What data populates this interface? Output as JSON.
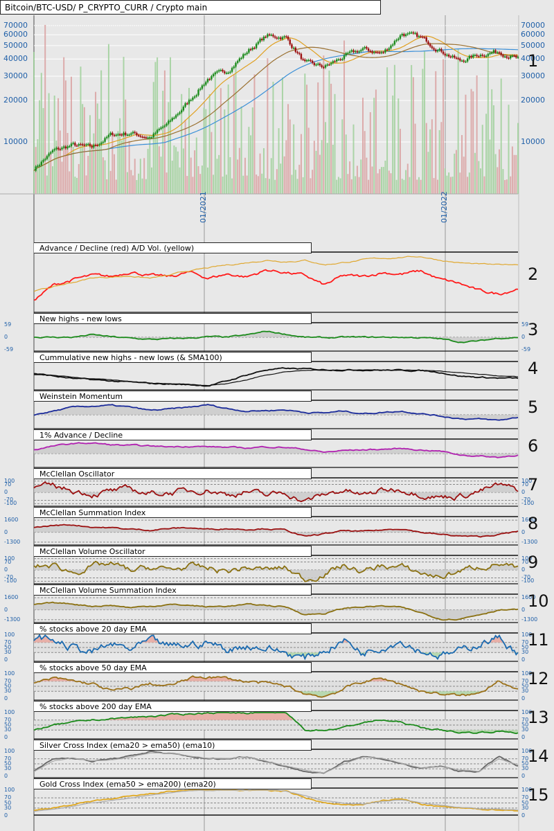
{
  "header": {
    "title": "Bitcoin/BTC-USD/ P_CRYPTO_CURR / Crypto main"
  },
  "price_labels": [
    "70000",
    "60000",
    "50000",
    "40000",
    "30000",
    "20000",
    "10000"
  ],
  "date_labels": [
    "01/2021",
    "01/2022"
  ],
  "colors": {
    "up": "#1a8a1a",
    "down": "#9b1010",
    "sma_slow": "#3a8fd8",
    "sma_mid": "#e0a020",
    "sma_long": "#9a7030",
    "vol_up": "#9fd09a",
    "vol_down": "#d9a0a0",
    "scale": "#1f5fa8"
  },
  "chart_data": [
    {
      "type": "candlestick",
      "title": "Bitcoin/BTC-USD",
      "panel": "1",
      "yscale": "log",
      "ylim": [
        5000,
        80000
      ],
      "x": [
        "2020-03",
        "2020-04",
        "2020-05",
        "2020-06",
        "2020-07",
        "2020-08",
        "2020-09",
        "2020-10",
        "2020-11",
        "2020-12",
        "2021-01",
        "2021-02",
        "2021-03",
        "2021-04",
        "2021-05",
        "2021-06",
        "2021-07",
        "2021-08",
        "2021-09",
        "2021-10",
        "2021-11",
        "2021-12",
        "2022-01",
        "2022-02",
        "2022-03",
        "2022-04"
      ],
      "close": [
        6400,
        8600,
        9500,
        9100,
        11300,
        11600,
        10800,
        13800,
        19700,
        29000,
        33000,
        45000,
        58800,
        57700,
        37300,
        35000,
        41500,
        47100,
        43800,
        61300,
        57000,
        46300,
        38500,
        43200,
        45500,
        40000
      ]
    },
    {
      "panel": "2",
      "type": "line",
      "title": "Advance / Decline (red) A/D Vol. (yellow)",
      "labels": [],
      "ylim": [
        0,
        1
      ],
      "series": [
        {
          "name": "A/D",
          "color": "#ff1a1a",
          "values": [
            0.2,
            0.45,
            0.55,
            0.62,
            0.6,
            0.7,
            0.62,
            0.6,
            0.68,
            0.58,
            0.65,
            0.6,
            0.72,
            0.68,
            0.62,
            0.45,
            0.62,
            0.6,
            0.68,
            0.65,
            0.7,
            0.55,
            0.48,
            0.35,
            0.3,
            0.4
          ]
        },
        {
          "name": "A/D Vol.",
          "color": "#e0a830",
          "values": [
            0.35,
            0.42,
            0.5,
            0.58,
            0.6,
            0.62,
            0.58,
            0.62,
            0.7,
            0.75,
            0.8,
            0.85,
            0.9,
            0.88,
            0.9,
            0.82,
            0.86,
            0.9,
            0.92,
            0.95,
            0.96,
            0.9,
            0.85,
            0.82,
            0.8,
            0.82
          ]
        }
      ]
    },
    {
      "panel": "3",
      "type": "line",
      "title": "New highs - new lows",
      "labels": [
        "59",
        "0",
        "-59"
      ],
      "ylim": [
        -59,
        59
      ],
      "fill": true,
      "refs": [
        0
      ],
      "series": [
        {
          "name": "NH-NL",
          "color": "#1a8a1a",
          "values": [
            0,
            0,
            0,
            12,
            2,
            -5,
            -10,
            -8,
            -4,
            2,
            0,
            10,
            28,
            15,
            0,
            -3,
            0,
            0,
            0,
            0,
            -2,
            -8,
            -22,
            -18,
            -4,
            0
          ]
        }
      ]
    },
    {
      "panel": "4",
      "type": "line",
      "title": "Cummulative new highs - new lows (& SMA100)",
      "labels": [],
      "ylim": [
        0,
        1
      ],
      "series": [
        {
          "name": "Cumulative",
          "color": "#111",
          "values": [
            0.6,
            0.5,
            0.4,
            0.35,
            0.3,
            0.25,
            0.2,
            0.18,
            0.15,
            0.12,
            0.3,
            0.55,
            0.75,
            0.8,
            0.78,
            0.76,
            0.75,
            0.75,
            0.74,
            0.73,
            0.72,
            0.65,
            0.5,
            0.45,
            0.42,
            0.4
          ]
        },
        {
          "name": "SMA100",
          "color": "#111",
          "values": [
            0.55,
            0.52,
            0.45,
            0.4,
            0.33,
            0.28,
            0.23,
            0.2,
            0.17,
            0.14,
            0.2,
            0.35,
            0.55,
            0.68,
            0.72,
            0.74,
            0.75,
            0.75,
            0.75,
            0.74,
            0.73,
            0.7,
            0.62,
            0.55,
            0.5,
            0.45
          ]
        }
      ]
    },
    {
      "panel": "5",
      "type": "line",
      "title": "Weinstein Momentum",
      "labels": [],
      "ylim": [
        -1,
        1
      ],
      "fill": true,
      "refs": [
        0
      ],
      "series": [
        {
          "name": "Momentum",
          "color": "#1a2a9a",
          "values": [
            0,
            0.3,
            0.6,
            0.7,
            0.75,
            0.6,
            0.35,
            0.45,
            0.6,
            0.8,
            0.5,
            0.3,
            0.35,
            0.4,
            0.2,
            0.15,
            0.3,
            0.1,
            0.2,
            0.3,
            0.1,
            -0.1,
            -0.3,
            -0.35,
            -0.45,
            -0.2
          ]
        }
      ]
    },
    {
      "panel": "6",
      "type": "line",
      "title": "1% Advance / Decline",
      "labels": [],
      "ylim": [
        -1,
        1
      ],
      "fill": true,
      "refs": [
        0
      ],
      "series": [
        {
          "name": "1% A/D",
          "color": "#b020b0",
          "values": [
            0.3,
            0.6,
            0.8,
            0.85,
            0.7,
            0.65,
            0.6,
            0.55,
            0.6,
            0.55,
            0.5,
            0.45,
            0.55,
            0.5,
            0.35,
            0.1,
            0.25,
            0.3,
            0.35,
            0.4,
            0.3,
            0.2,
            -0.1,
            -0.2,
            -0.3,
            -0.1
          ]
        }
      ]
    },
    {
      "panel": "7",
      "type": "line",
      "title": "McClellan Oscillator",
      "labels": [
        "100",
        "70",
        "0",
        "-70",
        "-100"
      ],
      "ylim": [
        -110,
        110
      ],
      "fill": true,
      "refs": [
        100,
        70,
        0,
        -70,
        -100
      ],
      "noise": 40,
      "series": [
        {
          "name": "Oscillator",
          "color": "#9b1010",
          "values": [
            40,
            50,
            20,
            -10,
            10,
            20,
            -10,
            0,
            10,
            30,
            -20,
            10,
            -30,
            0,
            -80,
            -20,
            20,
            -30,
            20,
            30,
            -10,
            -40,
            -30,
            10,
            60,
            20
          ]
        }
      ]
    },
    {
      "panel": "8",
      "type": "line",
      "title": "McClellan Summation Index",
      "labels": [
        "1600",
        "0",
        "-1300"
      ],
      "ylim": [
        -1500,
        1800
      ],
      "fill": true,
      "refs": [
        1600,
        0,
        -1300
      ],
      "series": [
        {
          "name": "Summation",
          "color": "#9b1010",
          "values": [
            600,
            900,
            1000,
            700,
            600,
            400,
            300,
            500,
            600,
            400,
            500,
            400,
            500,
            300,
            -600,
            -200,
            200,
            100,
            300,
            500,
            0,
            -300,
            -500,
            -600,
            -300,
            100
          ]
        }
      ]
    },
    {
      "panel": "9",
      "type": "line",
      "title": "McClellan Volume Oscillator",
      "labels": [
        "100",
        "70",
        "0",
        "-70",
        "-100"
      ],
      "ylim": [
        -110,
        110
      ],
      "fill": true,
      "refs": [
        100,
        70,
        0,
        -70,
        -100
      ],
      "noise": 40,
      "series": [
        {
          "name": "Vol Oscillator",
          "color": "#8a7010",
          "values": [
            30,
            40,
            -20,
            30,
            50,
            -10,
            20,
            0,
            30,
            10,
            -10,
            20,
            0,
            20,
            -90,
            -30,
            40,
            -20,
            40,
            20,
            -30,
            -60,
            -10,
            30,
            60,
            0
          ]
        }
      ]
    },
    {
      "panel": "10",
      "type": "line",
      "title": "McClellan Volume Summation Index",
      "labels": [
        "1600",
        "0",
        "-1300"
      ],
      "ylim": [
        -1500,
        1800
      ],
      "fill": true,
      "refs": [
        1600,
        0,
        -1300
      ],
      "series": [
        {
          "name": "Vol Summation",
          "color": "#8a7010",
          "values": [
            700,
            900,
            800,
            500,
            600,
            300,
            500,
            700,
            600,
            400,
            500,
            700,
            600,
            400,
            -600,
            -500,
            200,
            400,
            500,
            300,
            -400,
            -1200,
            -1200,
            -600,
            0,
            0
          ]
        }
      ]
    },
    {
      "panel": "11",
      "type": "line",
      "title": "% stocks above 20 day EMA",
      "labels": [
        "100",
        "70",
        "50",
        "30",
        "0"
      ],
      "ylim": [
        0,
        100
      ],
      "refs": [
        70,
        50,
        30
      ],
      "band": [
        30,
        70
      ],
      "noise": 25,
      "series": [
        {
          "name": "% > EMA20",
          "color": "#1a6ab0",
          "values": [
            90,
            80,
            50,
            30,
            60,
            40,
            70,
            50,
            60,
            70,
            40,
            60,
            50,
            30,
            5,
            40,
            80,
            30,
            60,
            80,
            40,
            20,
            30,
            70,
            90,
            30
          ]
        }
      ]
    },
    {
      "panel": "12",
      "type": "line",
      "title": "% stocks above 50 day EMA",
      "labels": [
        "100",
        "70",
        "50",
        "30",
        "0"
      ],
      "ylim": [
        0,
        100
      ],
      "refs": [
        70,
        50,
        30
      ],
      "band": [
        30,
        70
      ],
      "noise": 10,
      "series": [
        {
          "name": "% > EMA50",
          "color": "#9a7018",
          "values": [
            60,
            80,
            70,
            60,
            30,
            40,
            60,
            50,
            80,
            90,
            80,
            70,
            60,
            50,
            20,
            10,
            40,
            70,
            80,
            60,
            30,
            20,
            10,
            20,
            80,
            30
          ]
        }
      ]
    },
    {
      "panel": "13",
      "type": "line",
      "title": "% stocks above 200 day EMA",
      "labels": [
        "100",
        "70",
        "50",
        "30",
        "0"
      ],
      "ylim": [
        0,
        100
      ],
      "refs": [
        70,
        50,
        30
      ],
      "band": [
        30,
        70
      ],
      "noise": 5,
      "series": [
        {
          "name": "% > EMA200",
          "color": "#1a8a1a",
          "values": [
            30,
            50,
            60,
            70,
            75,
            80,
            85,
            90,
            95,
            100,
            100,
            100,
            100,
            100,
            30,
            30,
            40,
            60,
            70,
            60,
            40,
            30,
            20,
            20,
            25,
            20
          ]
        }
      ]
    },
    {
      "panel": "14",
      "type": "line",
      "title": "Silver Cross Index (ema20 > ema50) (ema10)",
      "labels": [
        "100",
        "70",
        "50",
        "30",
        "0"
      ],
      "ylim": [
        0,
        100
      ],
      "refs": [
        70,
        50,
        30
      ],
      "series": [
        {
          "name": "Silver Cross",
          "color": "#666",
          "values": [
            20,
            70,
            75,
            60,
            70,
            80,
            100,
            90,
            80,
            70,
            70,
            80,
            60,
            40,
            20,
            10,
            60,
            80,
            70,
            50,
            30,
            40,
            20,
            20,
            80,
            40
          ]
        },
        {
          "name": "ema10",
          "color": "#aaa",
          "values": [
            18,
            60,
            75,
            62,
            68,
            78,
            95,
            92,
            82,
            72,
            70,
            78,
            62,
            42,
            24,
            14,
            50,
            78,
            72,
            52,
            34,
            38,
            24,
            20,
            70,
            45
          ]
        }
      ]
    },
    {
      "panel": "15",
      "type": "line",
      "title": "Gold Cross Index (ema50 > ema200) (ema20)",
      "labels": [
        "100",
        "70",
        "50",
        "30",
        "0"
      ],
      "ylim": [
        0,
        100
      ],
      "refs": [
        70,
        50,
        30
      ],
      "series": [
        {
          "name": "Gold Cross",
          "color": "#e0a820",
          "values": [
            20,
            30,
            45,
            55,
            65,
            75,
            85,
            95,
            100,
            100,
            100,
            100,
            100,
            95,
            70,
            50,
            40,
            45,
            60,
            65,
            45,
            35,
            30,
            25,
            25,
            20
          ]
        },
        {
          "name": "ema20",
          "color": "#aaa",
          "values": [
            18,
            25,
            38,
            50,
            60,
            70,
            80,
            90,
            98,
            100,
            100,
            100,
            100,
            98,
            80,
            60,
            48,
            45,
            55,
            62,
            52,
            42,
            34,
            28,
            26,
            22
          ]
        }
      ]
    }
  ]
}
